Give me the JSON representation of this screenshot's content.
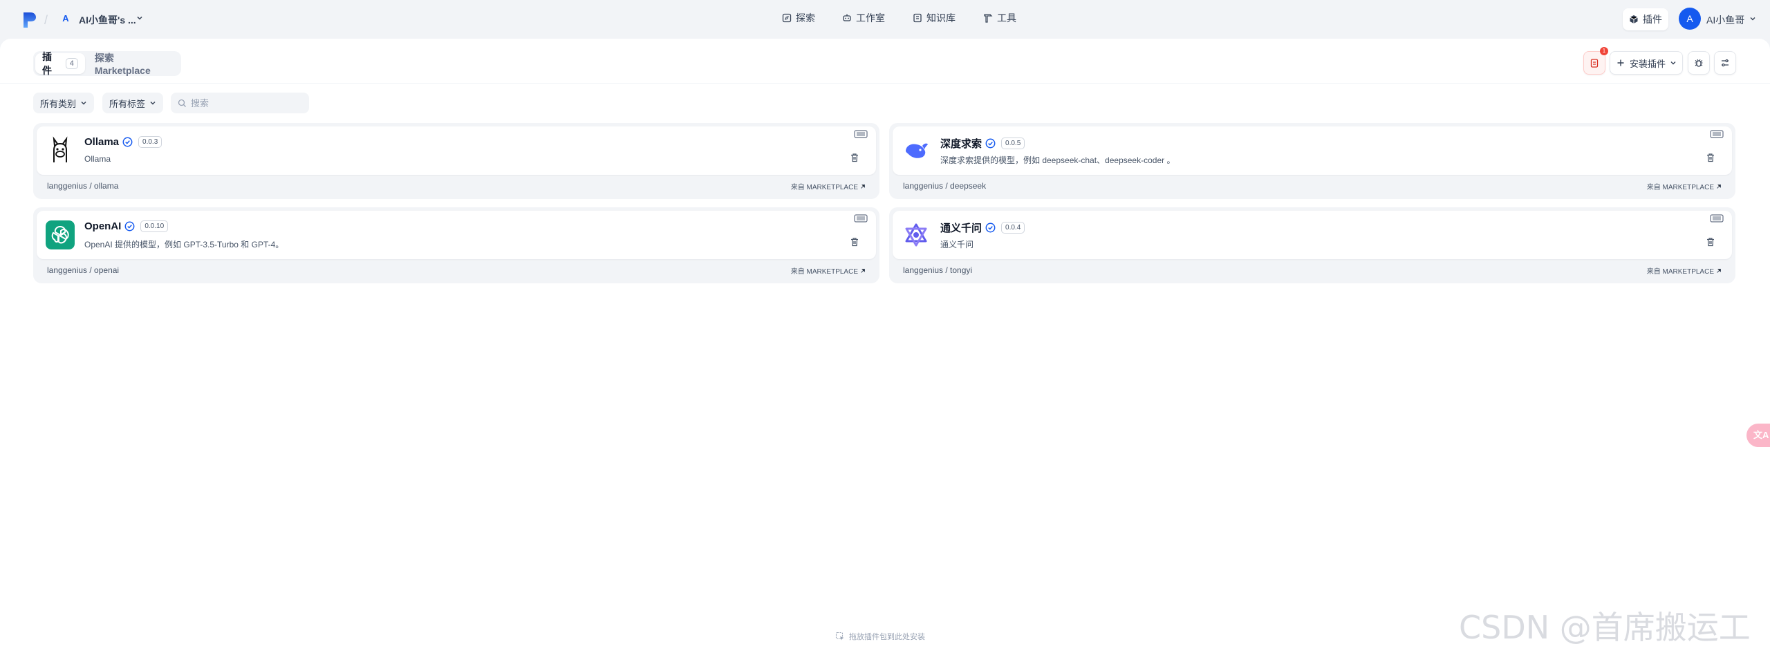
{
  "header": {
    "workspace_initial": "A",
    "workspace_name": "AI小鱼哥's ...",
    "nav": [
      {
        "label": "探索",
        "icon": "compass-icon"
      },
      {
        "label": "工作室",
        "icon": "robot-icon"
      },
      {
        "label": "知识库",
        "icon": "book-icon"
      },
      {
        "label": "工具",
        "icon": "hammer-icon"
      }
    ],
    "plugin_label": "插件",
    "user_initial": "A",
    "user_name": "AI小鱼哥"
  },
  "tabs": [
    {
      "label": "插件",
      "count": "4",
      "active": true
    },
    {
      "label": "探索 Marketplace",
      "active": false
    }
  ],
  "toolbar": {
    "notification_count": "1",
    "install_label": "安装插件"
  },
  "filters": {
    "category": "所有类别",
    "tags": "所有标签",
    "search_placeholder": "搜索"
  },
  "plugins": [
    {
      "name": "Ollama",
      "version": "0.0.3",
      "description": "Ollama",
      "repo": "langgenius / ollama",
      "source": "来自 MARKETPLACE",
      "icon": "ollama-llama-icon"
    },
    {
      "name": "深度求索",
      "version": "0.0.5",
      "description": "深度求索提供的模型，例如 deepseek-chat、deepseek-coder 。",
      "repo": "langgenius / deepseek",
      "source": "来自 MARKETPLACE",
      "icon": "deepseek-whale-icon"
    },
    {
      "name": "OpenAI",
      "version": "0.0.10",
      "description": "OpenAI 提供的模型，例如 GPT-3.5-Turbo 和 GPT-4。",
      "repo": "langgenius / openai",
      "source": "来自 MARKETPLACE",
      "icon": "openai-logo-icon"
    },
    {
      "name": "通义千问",
      "version": "0.0.4",
      "description": "通义千问",
      "repo": "langgenius / tongyi",
      "source": "来自 MARKETPLACE",
      "icon": "tongyi-logo-icon"
    }
  ],
  "footer": {
    "drop_hint": "拖放插件包到此处安装",
    "translate": "文A",
    "watermark": "CSDN @首席搬运工"
  },
  "colors": {
    "accent": "#155aef",
    "danger": "#f04438",
    "page_bg": "#f2f4f7"
  }
}
